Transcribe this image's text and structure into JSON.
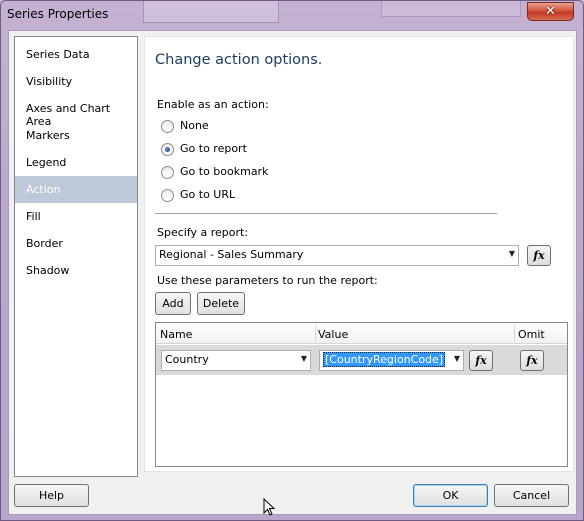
{
  "window": {
    "title": "Series Properties",
    "close_glyph": "✕"
  },
  "nav": {
    "items": [
      {
        "label": "Series Data",
        "selected": false
      },
      {
        "label": "Visibility",
        "selected": false
      },
      {
        "label": "Axes and Chart Area",
        "selected": false
      },
      {
        "label": "Markers",
        "selected": false
      },
      {
        "label": "Legend",
        "selected": false
      },
      {
        "label": "Action",
        "selected": true
      },
      {
        "label": "Fill",
        "selected": false
      },
      {
        "label": "Border",
        "selected": false
      },
      {
        "label": "Shadow",
        "selected": false
      }
    ]
  },
  "content": {
    "heading": "Change action options.",
    "enable_label": "Enable as an action:",
    "radios": [
      {
        "label": "None",
        "checked": false
      },
      {
        "label": "Go to report",
        "checked": true
      },
      {
        "label": "Go to bookmark",
        "checked": false
      },
      {
        "label": "Go to URL",
        "checked": false
      }
    ],
    "specify_label": "Specify a report:",
    "report_value": "Regional - Sales Summary",
    "fx_label": "fx",
    "params_label": "Use these parameters to run the report:",
    "add_label": "Add",
    "delete_label": "Delete",
    "grid": {
      "headers": {
        "name": "Name",
        "value": "Value",
        "omit": "Omit"
      },
      "rows": [
        {
          "name": "Country",
          "value": "[CountryRegionCode]"
        }
      ]
    }
  },
  "footer": {
    "help_label": "Help",
    "ok_label": "OK",
    "cancel_label": "Cancel"
  },
  "colors": {
    "nav_selected_bg": "#bdc8d8",
    "heading": "#1e3a5f",
    "selection": "#3399ff",
    "close_button": "#c23a22"
  }
}
